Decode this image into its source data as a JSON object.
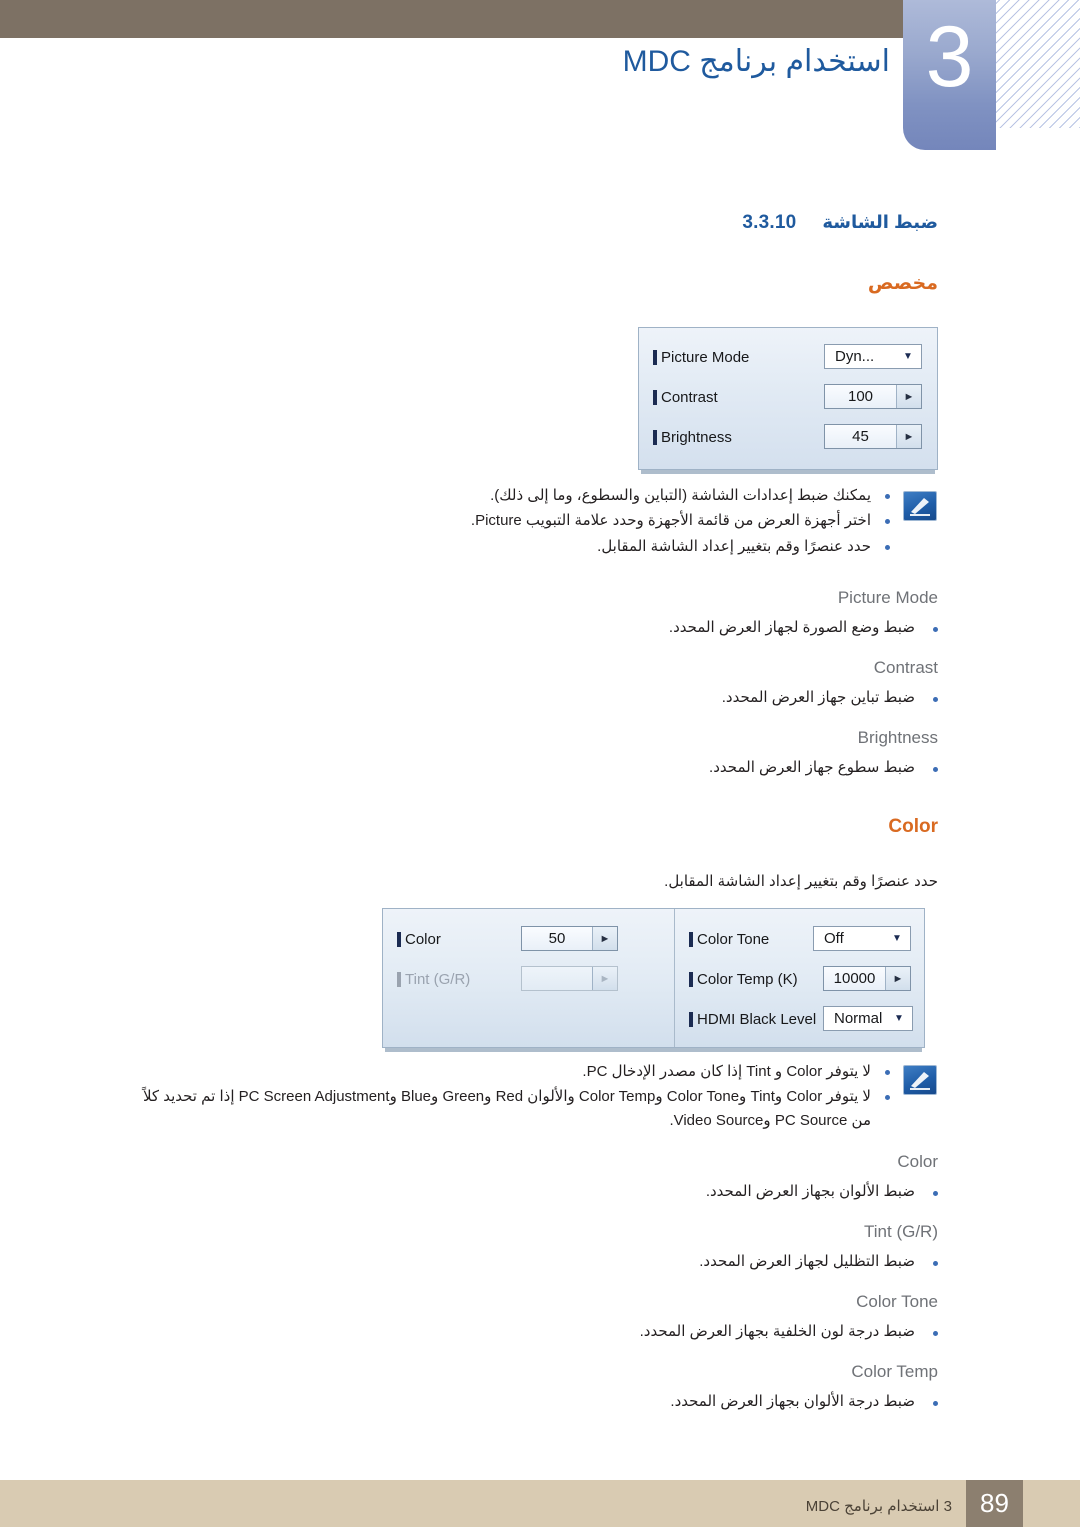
{
  "header": {
    "chapter_number": "3",
    "chapter_title": "استخدام برنامج MDC"
  },
  "section": {
    "number": "3.3.10",
    "title": "ضبط الشاشة"
  },
  "custom_section": {
    "heading": "مخصص",
    "panel": {
      "rows": [
        {
          "label": "Picture Mode",
          "value": "Dyn...",
          "control": "combo"
        },
        {
          "label": "Contrast",
          "value": "100",
          "control": "spin"
        },
        {
          "label": "Brightness",
          "value": "45",
          "control": "spin"
        }
      ]
    },
    "notes": [
      "يمكنك ضبط إعدادات الشاشة (التباين والسطوع، وما إلى ذلك).",
      "اختر أجهزة العرض من قائمة الأجهزة وحدد علامة التبويب Picture.",
      "حدد عنصرًا وقم بتغيير إعداد الشاشة المقابل."
    ],
    "terms": [
      {
        "name": "Picture Mode",
        "desc": "ضبط وضع الصورة لجهاز العرض المحدد."
      },
      {
        "name": "Contrast",
        "desc": "ضبط تباين جهاز العرض المحدد."
      },
      {
        "name": "Brightness",
        "desc": "ضبط سطوع جهاز العرض المحدد."
      }
    ]
  },
  "color_section": {
    "heading": "Color",
    "intro": "حدد عنصرًا وقم بتغيير إعداد الشاشة المقابل.",
    "panel": {
      "left_rows": [
        {
          "label": "Color",
          "value": "50",
          "control": "spin",
          "disabled": false
        },
        {
          "label": "Tint (G/R)",
          "value": "",
          "control": "spin",
          "disabled": true
        }
      ],
      "right_rows": [
        {
          "label": "Color Tone",
          "value": "Off",
          "control": "combo",
          "disabled": false
        },
        {
          "label": "Color Temp (K)",
          "value": "10000",
          "control": "spin",
          "disabled": false
        },
        {
          "label": "HDMI Black Level",
          "value": "Normal",
          "control": "combo",
          "disabled": false
        }
      ]
    },
    "notes": [
      "لا يتوفر Color و Tint إذا كان مصدر الإدخال PC.",
      "لا يتوفر Color وTint وColor Tone وColor Temp والألوان Red وGreen وBlue وPC Screen Adjustment إذا تم تحديد كلاً من PC Source وVideo Source."
    ],
    "terms": [
      {
        "name": "Color",
        "desc": "ضبط الألوان بجهاز العرض المحدد."
      },
      {
        "name": "Tint (G/R)",
        "desc": "ضبط التظليل لجهاز العرض المحدد."
      },
      {
        "name": "Color Tone",
        "desc": "ضبط درجة لون الخلفية بجهاز العرض المحدد."
      },
      {
        "name": "Color Temp",
        "desc": "ضبط درجة الألوان بجهاز العرض المحدد."
      }
    ]
  },
  "footer": {
    "text": "3 استخدام برنامج MDC",
    "page": "89"
  },
  "colors": {
    "header_bar": "#7d7164",
    "heading_blue": "#1f5a9e",
    "heading_orange": "#d96a21",
    "term_grey": "#6f7277",
    "bullet_blue": "#3c6db5",
    "footer_band": "#d9cbb2",
    "footer_page_box": "#8c7f6f"
  }
}
